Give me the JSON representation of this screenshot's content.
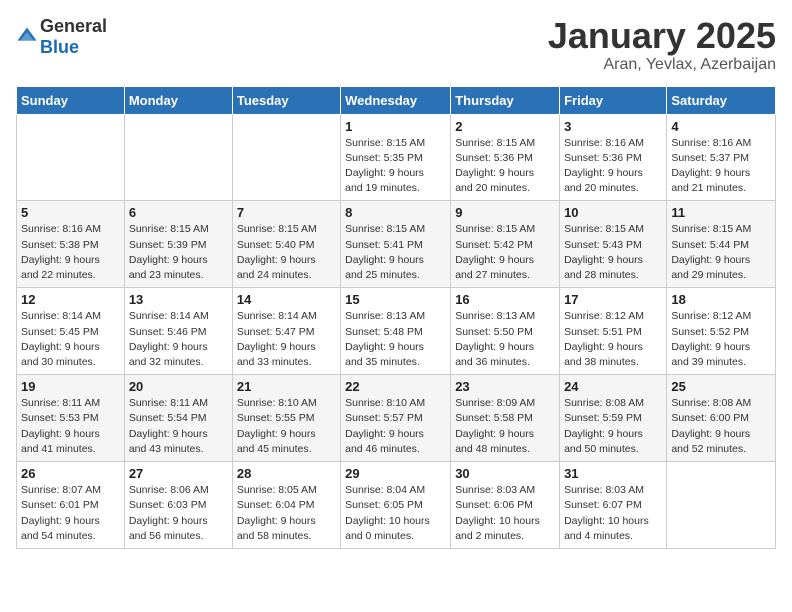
{
  "header": {
    "logo_general": "General",
    "logo_blue": "Blue",
    "title": "January 2025",
    "subtitle": "Aran, Yevlax, Azerbaijan"
  },
  "weekdays": [
    "Sunday",
    "Monday",
    "Tuesday",
    "Wednesday",
    "Thursday",
    "Friday",
    "Saturday"
  ],
  "weeks": [
    [
      {
        "day": "",
        "info": ""
      },
      {
        "day": "",
        "info": ""
      },
      {
        "day": "",
        "info": ""
      },
      {
        "day": "1",
        "info": "Sunrise: 8:15 AM\nSunset: 5:35 PM\nDaylight: 9 hours\nand 19 minutes."
      },
      {
        "day": "2",
        "info": "Sunrise: 8:15 AM\nSunset: 5:36 PM\nDaylight: 9 hours\nand 20 minutes."
      },
      {
        "day": "3",
        "info": "Sunrise: 8:16 AM\nSunset: 5:36 PM\nDaylight: 9 hours\nand 20 minutes."
      },
      {
        "day": "4",
        "info": "Sunrise: 8:16 AM\nSunset: 5:37 PM\nDaylight: 9 hours\nand 21 minutes."
      }
    ],
    [
      {
        "day": "5",
        "info": "Sunrise: 8:16 AM\nSunset: 5:38 PM\nDaylight: 9 hours\nand 22 minutes."
      },
      {
        "day": "6",
        "info": "Sunrise: 8:15 AM\nSunset: 5:39 PM\nDaylight: 9 hours\nand 23 minutes."
      },
      {
        "day": "7",
        "info": "Sunrise: 8:15 AM\nSunset: 5:40 PM\nDaylight: 9 hours\nand 24 minutes."
      },
      {
        "day": "8",
        "info": "Sunrise: 8:15 AM\nSunset: 5:41 PM\nDaylight: 9 hours\nand 25 minutes."
      },
      {
        "day": "9",
        "info": "Sunrise: 8:15 AM\nSunset: 5:42 PM\nDaylight: 9 hours\nand 27 minutes."
      },
      {
        "day": "10",
        "info": "Sunrise: 8:15 AM\nSunset: 5:43 PM\nDaylight: 9 hours\nand 28 minutes."
      },
      {
        "day": "11",
        "info": "Sunrise: 8:15 AM\nSunset: 5:44 PM\nDaylight: 9 hours\nand 29 minutes."
      }
    ],
    [
      {
        "day": "12",
        "info": "Sunrise: 8:14 AM\nSunset: 5:45 PM\nDaylight: 9 hours\nand 30 minutes."
      },
      {
        "day": "13",
        "info": "Sunrise: 8:14 AM\nSunset: 5:46 PM\nDaylight: 9 hours\nand 32 minutes."
      },
      {
        "day": "14",
        "info": "Sunrise: 8:14 AM\nSunset: 5:47 PM\nDaylight: 9 hours\nand 33 minutes."
      },
      {
        "day": "15",
        "info": "Sunrise: 8:13 AM\nSunset: 5:48 PM\nDaylight: 9 hours\nand 35 minutes."
      },
      {
        "day": "16",
        "info": "Sunrise: 8:13 AM\nSunset: 5:50 PM\nDaylight: 9 hours\nand 36 minutes."
      },
      {
        "day": "17",
        "info": "Sunrise: 8:12 AM\nSunset: 5:51 PM\nDaylight: 9 hours\nand 38 minutes."
      },
      {
        "day": "18",
        "info": "Sunrise: 8:12 AM\nSunset: 5:52 PM\nDaylight: 9 hours\nand 39 minutes."
      }
    ],
    [
      {
        "day": "19",
        "info": "Sunrise: 8:11 AM\nSunset: 5:53 PM\nDaylight: 9 hours\nand 41 minutes."
      },
      {
        "day": "20",
        "info": "Sunrise: 8:11 AM\nSunset: 5:54 PM\nDaylight: 9 hours\nand 43 minutes."
      },
      {
        "day": "21",
        "info": "Sunrise: 8:10 AM\nSunset: 5:55 PM\nDaylight: 9 hours\nand 45 minutes."
      },
      {
        "day": "22",
        "info": "Sunrise: 8:10 AM\nSunset: 5:57 PM\nDaylight: 9 hours\nand 46 minutes."
      },
      {
        "day": "23",
        "info": "Sunrise: 8:09 AM\nSunset: 5:58 PM\nDaylight: 9 hours\nand 48 minutes."
      },
      {
        "day": "24",
        "info": "Sunrise: 8:08 AM\nSunset: 5:59 PM\nDaylight: 9 hours\nand 50 minutes."
      },
      {
        "day": "25",
        "info": "Sunrise: 8:08 AM\nSunset: 6:00 PM\nDaylight: 9 hours\nand 52 minutes."
      }
    ],
    [
      {
        "day": "26",
        "info": "Sunrise: 8:07 AM\nSunset: 6:01 PM\nDaylight: 9 hours\nand 54 minutes."
      },
      {
        "day": "27",
        "info": "Sunrise: 8:06 AM\nSunset: 6:03 PM\nDaylight: 9 hours\nand 56 minutes."
      },
      {
        "day": "28",
        "info": "Sunrise: 8:05 AM\nSunset: 6:04 PM\nDaylight: 9 hours\nand 58 minutes."
      },
      {
        "day": "29",
        "info": "Sunrise: 8:04 AM\nSunset: 6:05 PM\nDaylight: 10 hours\nand 0 minutes."
      },
      {
        "day": "30",
        "info": "Sunrise: 8:03 AM\nSunset: 6:06 PM\nDaylight: 10 hours\nand 2 minutes."
      },
      {
        "day": "31",
        "info": "Sunrise: 8:03 AM\nSunset: 6:07 PM\nDaylight: 10 hours\nand 4 minutes."
      },
      {
        "day": "",
        "info": ""
      }
    ]
  ]
}
